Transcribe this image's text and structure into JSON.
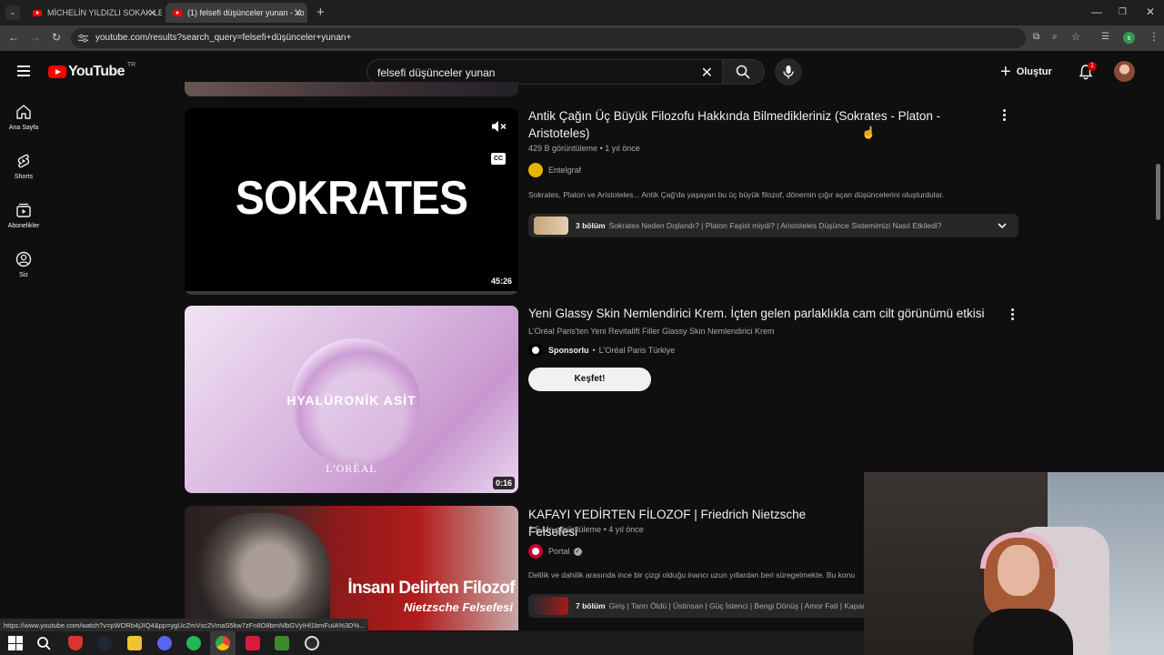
{
  "browser": {
    "tabs": [
      {
        "title": "MİCHELİN YILDIZLI SOKAK LEZZ...",
        "active": false
      },
      {
        "title": "(1) felsefi düşünceler yunan - Yo",
        "active": true
      }
    ],
    "new_tab": "+",
    "url": "youtube.com/results?search_query=felsefi+düşünceler+yunan+",
    "profile_initial": "s"
  },
  "youtube": {
    "logo_text": "YouTube",
    "region": "TR",
    "search_value": "felsefi düşünceler yunan",
    "create_label": "Oluştur",
    "notification_count": "1"
  },
  "sidebar": {
    "items": [
      {
        "label": "Ana Sayfa",
        "icon": "home-icon"
      },
      {
        "label": "Shorts",
        "icon": "shorts-icon"
      },
      {
        "label": "Abonelikler",
        "icon": "subscriptions-icon"
      },
      {
        "label": "Siz",
        "icon": "you-icon"
      }
    ]
  },
  "results": [
    {
      "thumb_text": "SOKRATES",
      "duration": "45:26",
      "title_line1": "Antik Çağın Üç Büyük Filozofu Hakkında Bilmedikleriniz (Sokrates - Platon -",
      "title_line2": "Aristoteles)",
      "views": "429 B görüntüleme",
      "age": "1 yıl önce",
      "channel": "Entelgraf",
      "description": "Sokrates, Platon ve Aristoteles... Antik Çağ'da yaşayan bu üç büyük filozof, dönemin çığır açan düşüncelerini oluşturdular.",
      "chapters_count": "3 bölüm",
      "chapters": "Sokrates Neden Dışlandı? | Platon Faşist miydi? | Aristoteles Düşünce Sistemimizi Nasıl Etkiledi?",
      "cc_label": "CC"
    },
    {
      "thumb_text": "HYALÜRONİK ASİT",
      "brand": "L'ORÉAL",
      "duration": "0:16",
      "title": "Yeni Glassy Skin Nemlendirici Krem. İçten gelen parlaklıkla cam cilt görünümü etkisi",
      "description": "L'Oréal Paris'ten Yeni Revitalift Filler Glassy Skin Nemlendirici Krem",
      "sponsor_label": "Sponsorlu",
      "advertiser": "L'Oréal Paris Türkiye",
      "cta": "Keşfet!"
    },
    {
      "thumb_line1": "İnsanı Delirten Filozof",
      "thumb_line2": "Nietzsche Felsefesi",
      "title": "KAFAYI YEDİRTEN FİLOZOF | Friedrich Nietzsche Felsefesi",
      "views": "2,5 Mn görüntüleme",
      "age": "4 yıl önce",
      "channel": "Portal",
      "description": "Delilik ve dahilik arasında ince bir çizgi olduğu inancı uzun yıllardan beri süregelmekte. Bu konu",
      "chapters_count": "7 bölüm",
      "chapters": "Giriş | Tanrı Öldü | Üstinsan | Güç İstenci | Bengi Dönüş | Amor Fati | Kapanış"
    }
  ],
  "meta_separator": "•",
  "status_url": "https://www.youtube.com/watch?v=pWORb4jJIQ4&pp=ygUcZmVsc2VmaS5kw7zFn8O8bmNlbGVyIHl1bmFuIA%3D%...",
  "colors": {
    "accent": "#ff0000",
    "background": "#0f0f0f",
    "chip": "#272727"
  }
}
